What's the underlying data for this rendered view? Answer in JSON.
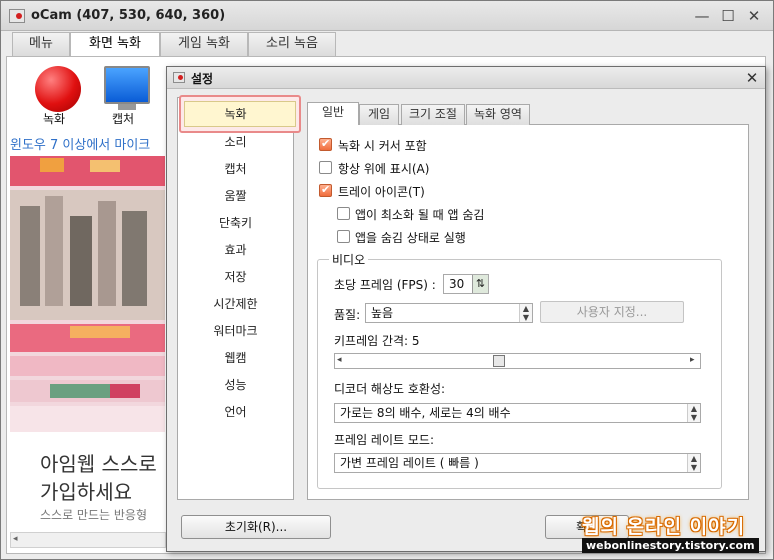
{
  "main_window": {
    "title": "oCam (407, 530, 640, 360)",
    "minimize": "—",
    "maximize": "☐",
    "close": "✕",
    "tabs": [
      "메뉴",
      "화면 녹화",
      "게임 녹화",
      "소리 녹음"
    ],
    "toolbar": {
      "record_label": "녹화",
      "capture_label": "캡처"
    }
  },
  "webpage": {
    "banner": "윈도우 7 이상에서 마이크",
    "heading_line1": "아임웹 스스로",
    "heading_line2": "가입하세요",
    "subtext": "스스로 만드는 반응형"
  },
  "dialog": {
    "title": "설정",
    "close": "✕",
    "categories": [
      "녹화",
      "소리",
      "캡처",
      "움짤",
      "단축키",
      "효과",
      "저장",
      "시간제한",
      "워터마크",
      "웹캠",
      "성능",
      "언어"
    ],
    "selected_category": "녹화",
    "tabs": [
      "일반",
      "게임",
      "크기 조절",
      "녹화 영역"
    ],
    "options": {
      "include_cursor": "녹화 시 커서 포함",
      "always_on_top": "항상 위에 표시(A)",
      "tray_icon": "트레이 아이콘(T)",
      "hide_on_minimize": "앱이 최소화 될 때 앱 숨김",
      "start_hidden": "앱을 숨김 상태로 실행"
    },
    "checked": {
      "include_cursor": true,
      "always_on_top": false,
      "tray_icon": true,
      "hide_on_minimize": false,
      "start_hidden": false
    },
    "video": {
      "group_title": "비디오",
      "fps_label": "초당 프레임 (FPS) :",
      "fps_value": "30",
      "quality_label": "품질:",
      "quality_value": "높음",
      "custom_button": "사용자 지정...",
      "keyframe_label": "키프레임 간격: 5",
      "keyframe_value": 5,
      "decoder_label": "디코더 해상도 호환성:",
      "decoder_value": "가로는 8의 배수, 세로는 4의 배수",
      "framerate_label": "프레임 레이트 모드:",
      "framerate_value": "가변 프레임 레이트 ( 빠름 )"
    },
    "reset_button": "초기화(R)...",
    "ok_button": "확인"
  },
  "watermark": {
    "title": "웹의 온라인 이야기",
    "url": "webonlinestory.tistory.com"
  }
}
